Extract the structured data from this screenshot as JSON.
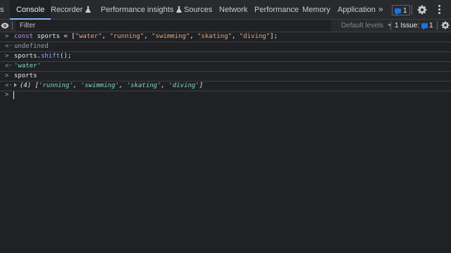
{
  "tabs": [
    {
      "label": "s",
      "active": false
    },
    {
      "label": "Console",
      "active": true
    },
    {
      "label": "Recorder",
      "active": false,
      "experimental": true
    },
    {
      "label": "Performance insights",
      "active": false,
      "experimental": true
    },
    {
      "label": "Sources",
      "active": false
    },
    {
      "label": "Network",
      "active": false
    },
    {
      "label": "Performance",
      "active": false
    },
    {
      "label": "Memory",
      "active": false
    },
    {
      "label": "Application",
      "active": false
    }
  ],
  "more_tabs": "»",
  "messages_badge": {
    "count": "1",
    "icon": "message-icon"
  },
  "toolbar": {
    "filter_placeholder": "Filter",
    "levels_label": "Default levels",
    "issues_label": "1 Issue:",
    "issues_count": "1"
  },
  "console": {
    "entries": [
      {
        "kind": "input",
        "gutter": ">",
        "tokens": [
          {
            "t": "const",
            "c": "kw"
          },
          {
            "t": " sports = [",
            "c": "plain"
          },
          {
            "t": "\"water\"",
            "c": "str"
          },
          {
            "t": ", ",
            "c": "plain"
          },
          {
            "t": "\"running\"",
            "c": "str"
          },
          {
            "t": ", ",
            "c": "plain"
          },
          {
            "t": "\"swimming\"",
            "c": "str"
          },
          {
            "t": ", ",
            "c": "plain"
          },
          {
            "t": "\"skating\"",
            "c": "str"
          },
          {
            "t": ", ",
            "c": "plain"
          },
          {
            "t": "\"diving\"",
            "c": "str"
          },
          {
            "t": "];",
            "c": "plain"
          }
        ]
      },
      {
        "kind": "output",
        "gutter": "<·",
        "tokens": [
          {
            "t": "undefined",
            "c": "undef"
          }
        ]
      },
      {
        "kind": "input",
        "gutter": ">",
        "tokens": [
          {
            "t": "sports.",
            "c": "plain"
          },
          {
            "t": "shift",
            "c": "fn"
          },
          {
            "t": "();",
            "c": "plain"
          }
        ]
      },
      {
        "kind": "output",
        "gutter": "<·",
        "tokens": [
          {
            "t": "'water'",
            "c": "qstr"
          }
        ]
      },
      {
        "kind": "input",
        "gutter": ">",
        "tokens": [
          {
            "t": "sports",
            "c": "plain"
          }
        ]
      },
      {
        "kind": "output",
        "gutter": "<·",
        "expandable": true,
        "tokens": [
          {
            "t": "(4) [",
            "c": "ital"
          },
          {
            "t": "'running'",
            "c": "ital-str"
          },
          {
            "t": ", ",
            "c": "ital"
          },
          {
            "t": "'swimming'",
            "c": "ital-str"
          },
          {
            "t": ", ",
            "c": "ital"
          },
          {
            "t": "'skating'",
            "c": "ital-str"
          },
          {
            "t": ", ",
            "c": "ital"
          },
          {
            "t": "'diving'",
            "c": "ital-str"
          },
          {
            "t": "]",
            "c": "ital"
          }
        ]
      }
    ],
    "prompt": ">"
  },
  "colors": {
    "background": "#202124",
    "toolbar": "#292a2d",
    "accent": "#8ab4f8",
    "badge_blue": "#1a73e8"
  }
}
